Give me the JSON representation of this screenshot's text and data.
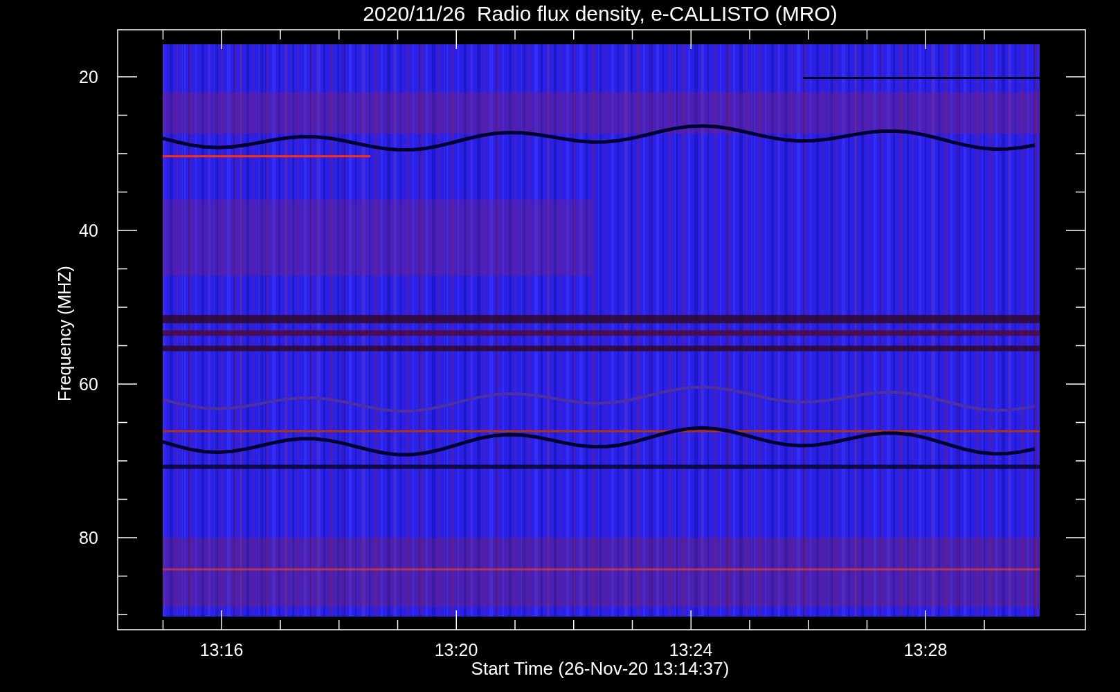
{
  "title": "2020/11/26  Radio flux density, e-CALLISTO (MRO)",
  "plot": {
    "ylabel": "Frequency (MHZ)",
    "xlabel": "Start Time (26-Nov-20 13:14:37)",
    "yticks": [
      "20",
      "40",
      "60",
      "80"
    ],
    "xticks": [
      "13:16",
      "13:20",
      "13:24",
      "13:28"
    ]
  }
}
